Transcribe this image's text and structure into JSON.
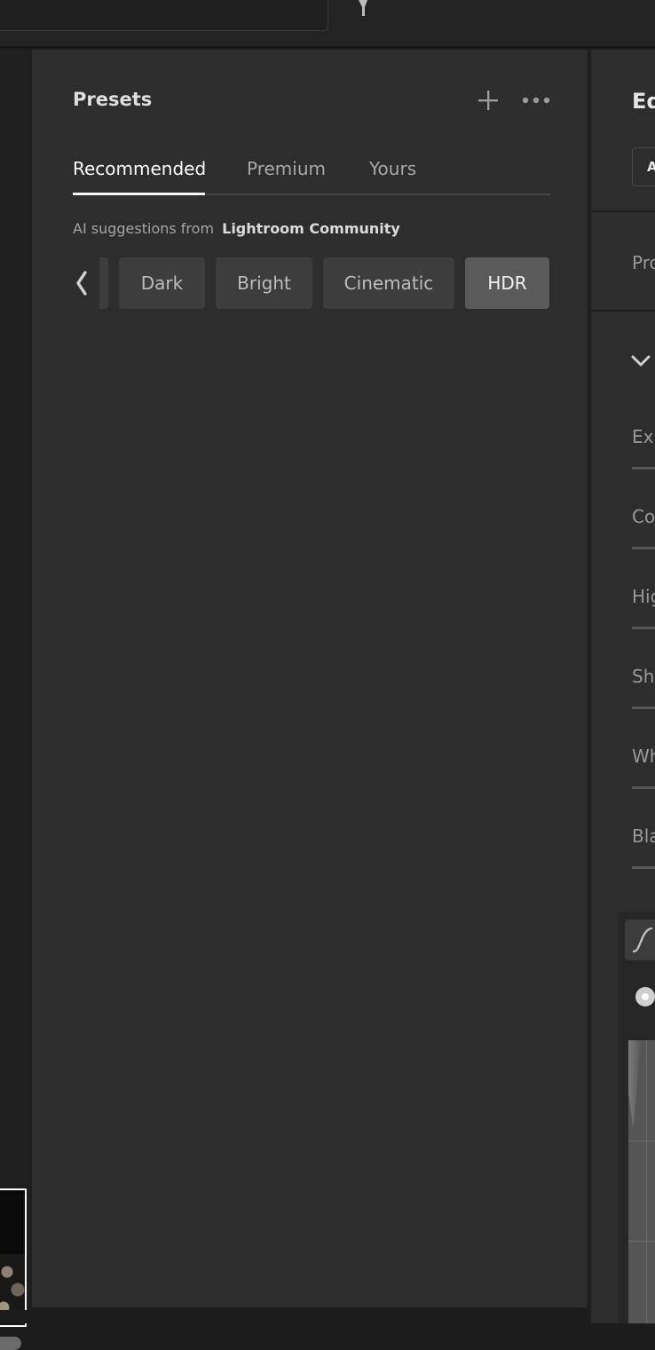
{
  "presets": {
    "title": "Presets",
    "tabs": [
      {
        "label": "Recommended",
        "active": true
      },
      {
        "label": "Premium",
        "active": false
      },
      {
        "label": "Yours",
        "active": false
      }
    ],
    "ai_note": {
      "prefix": "AI suggestions from",
      "source": "Lightroom Community"
    },
    "chips": [
      {
        "label": "Dark",
        "selected": false
      },
      {
        "label": "Bright",
        "selected": false
      },
      {
        "label": "Cinematic",
        "selected": false
      },
      {
        "label": "HDR",
        "selected": true
      }
    ]
  },
  "edit_panel": {
    "header": "Ed",
    "auto_label": "A",
    "profile_label": "Pro",
    "sliders": [
      "Exp",
      "Co",
      "Hig",
      "Sha",
      "Wh",
      "Bla"
    ]
  },
  "colors": {
    "panel_bg": "#2d2d2d",
    "chip_bg": "#3d3d3d",
    "chip_selected_bg": "#5a5a5a",
    "app_bg": "#1c1c1c"
  }
}
